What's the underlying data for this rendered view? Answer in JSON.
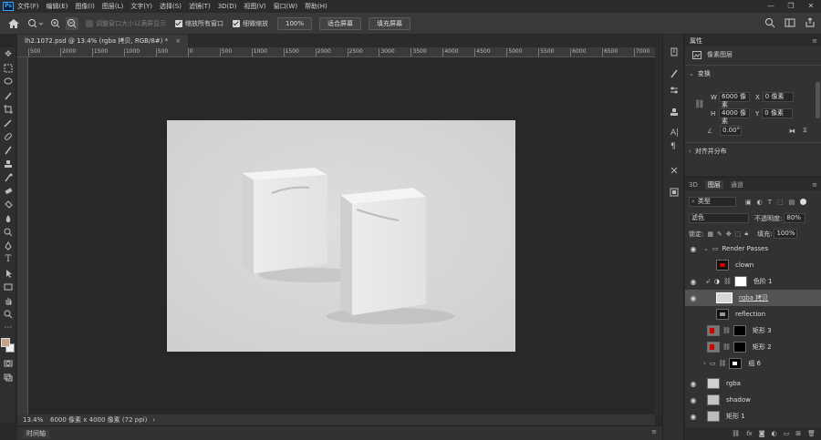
{
  "menu": {
    "logo": "Ps",
    "items": [
      "文件(F)",
      "编辑(E)",
      "图像(I)",
      "图层(L)",
      "文字(Y)",
      "选择(S)",
      "滤镜(T)",
      "3D(D)",
      "视图(V)",
      "窗口(W)",
      "帮助(H)"
    ],
    "window_controls": [
      "—",
      "❐",
      "✕"
    ]
  },
  "options": {
    "resize_label": "调整窗口大小以满屏显示",
    "zoom_all_label": "缩放所有窗口",
    "scrubby_label": "细微缩放",
    "zoom_value": "100%",
    "fit_screen": "适合屏幕",
    "fill_screen": "填充屏幕"
  },
  "document": {
    "tab_title": "lh2.1072.psd @ 13.4% (rgba 拷贝, RGB/8#) *",
    "tab_close": "×",
    "zoom": "13.4%",
    "doc_info": "6000 像素 x 4000 像素 (72 ppi)",
    "status_arrow": "›"
  },
  "ruler": {
    "ticks": [
      "500",
      "2000",
      "1500",
      "1000",
      "500",
      "0",
      "500",
      "1000",
      "1500",
      "2000",
      "2500",
      "3000",
      "3500",
      "4000",
      "4500",
      "5000",
      "5500",
      "6000",
      "6500",
      "7000"
    ]
  },
  "timeline": {
    "label": "时间轴"
  },
  "properties": {
    "title": "属性",
    "layer_type": "像素图层",
    "transform_title": "变换",
    "w_label": "W",
    "w_value": "6000 像素",
    "x_label": "X",
    "x_value": "0 像素",
    "h_label": "H",
    "h_value": "4000 像素",
    "y_label": "Y",
    "y_value": "0 像素",
    "angle_value": "0.00°",
    "align_title": "对齐并分布"
  },
  "layers_panel": {
    "tabs": [
      "3D",
      "图层",
      "通道"
    ],
    "filter_label": "类型",
    "blend_mode": "滤色",
    "opacity_label": "不透明度:",
    "opacity_value": "80%",
    "lock_label": "锁定:",
    "fill_label": "填充:",
    "fill_value": "100%",
    "layers": [
      {
        "name": "Render Passes",
        "visible": true
      },
      {
        "name": "clown",
        "visible": false
      },
      {
        "name": "色阶 1",
        "visible": true
      },
      {
        "name": "rgba 拷贝",
        "visible": true
      },
      {
        "name": "reflection",
        "visible": false
      },
      {
        "name": "矩形 3",
        "visible": false
      },
      {
        "name": "矩形 2",
        "visible": false
      },
      {
        "name": "组 6",
        "visible": false
      },
      {
        "name": "rgba",
        "visible": true
      },
      {
        "name": "shadow",
        "visible": true
      },
      {
        "name": "矩形 1",
        "visible": true
      }
    ]
  },
  "colors": {
    "foreground": "#c9a183",
    "background": "#f0f0f0",
    "accent": "#31a8ff"
  }
}
